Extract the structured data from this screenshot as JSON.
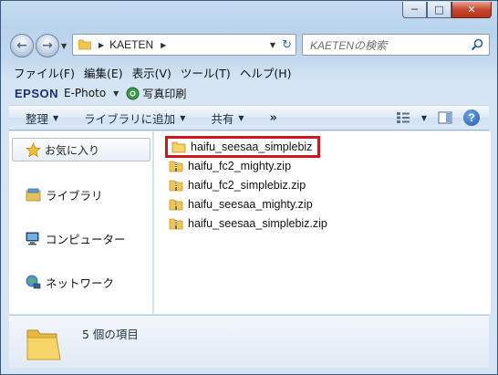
{
  "address": {
    "path": "KAETEN",
    "search_placeholder": "KAETENの検索"
  },
  "menu": [
    "ファイル(F)",
    "編集(E)",
    "表示(V)",
    "ツール(T)",
    "ヘルプ(H)"
  ],
  "epson": {
    "brand": "EPSON",
    "product": "E-Photo",
    "print_label": "写真印刷"
  },
  "commands": {
    "organize": "整理",
    "add_to_library": "ライブラリに追加",
    "share": "共有",
    "more": "»"
  },
  "nav": {
    "favorites": "お気に入り",
    "libraries": "ライブラリ",
    "computer": "コンピューター",
    "network": "ネットワーク"
  },
  "files": [
    {
      "name": "haifu_seesaa_simplebiz",
      "type": "folder"
    },
    {
      "name": "haifu_fc2_mighty.zip",
      "type": "zip"
    },
    {
      "name": "haifu_fc2_simplebiz.zip",
      "type": "zip"
    },
    {
      "name": "haifu_seesaa_mighty.zip",
      "type": "zip"
    },
    {
      "name": "haifu_seesaa_simplebiz.zip",
      "type": "zip"
    }
  ],
  "details": {
    "item_count": "5 個の項目"
  },
  "colors": {
    "highlight_border": "#d0161d",
    "folder": "#f2c54b",
    "accent": "#2c6fb5"
  }
}
